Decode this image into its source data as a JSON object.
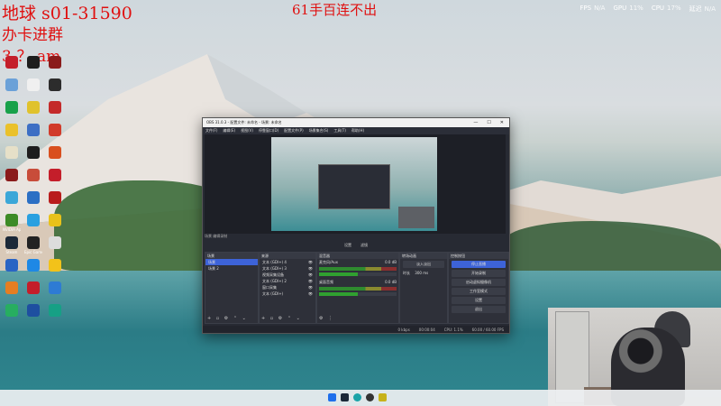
{
  "overlay": {
    "line1": "地球 s01-31590",
    "line2": "办卡进群",
    "line3": "3-？ am",
    "center": "61手百连不出"
  },
  "stats": {
    "fps_label": "FPS",
    "fps_value": "N/A",
    "gpu_label": "GPU",
    "gpu_value": "11%",
    "cpu_label": "CPU",
    "cpu_value": "17%",
    "latency_label": "延迟",
    "latency_value": "N/A"
  },
  "desktop_icons": [
    {
      "label": "",
      "color": "#c41e2a"
    },
    {
      "label": "",
      "color": "#1d1d1d"
    },
    {
      "label": "",
      "color": "#8a1b1b"
    },
    {
      "label": "",
      "color": "#6ba1d8"
    },
    {
      "label": "",
      "color": "#f0f0f0"
    },
    {
      "label": "",
      "color": "#2c2c2c"
    },
    {
      "label": "",
      "color": "#18a14a"
    },
    {
      "label": "",
      "color": "#e0c22c"
    },
    {
      "label": "",
      "color": "#c42a2a"
    },
    {
      "label": "",
      "color": "#eac12a"
    },
    {
      "label": "",
      "color": "#3c6fc4"
    },
    {
      "label": "",
      "color": "#d13b2a"
    },
    {
      "label": "",
      "color": "#e6e0c8"
    },
    {
      "label": "",
      "color": "#1d1d1d"
    },
    {
      "label": "",
      "color": "#d94f1e"
    },
    {
      "label": "",
      "color": "#8a1b1b"
    },
    {
      "label": "",
      "color": "#c84c3a"
    },
    {
      "label": "",
      "color": "#c41e2a"
    },
    {
      "label": "",
      "color": "#3ba7d8"
    },
    {
      "label": "",
      "color": "#2b6fc4"
    },
    {
      "label": "",
      "color": "#b91c1c"
    },
    {
      "label": "NVIDIA App",
      "color": "#3d8b26"
    },
    {
      "label": "",
      "color": "#2aa0e0"
    },
    {
      "label": "",
      "color": "#e8c21a"
    },
    {
      "label": "Steam",
      "color": "#1b2838"
    },
    {
      "label": "Epic Games",
      "color": "#222"
    },
    {
      "label": "",
      "color": "#dcdcdc"
    },
    {
      "label": "",
      "color": "#2a64c4"
    },
    {
      "label": "",
      "color": "#1e88e5"
    },
    {
      "label": "",
      "color": "#f2c21a"
    },
    {
      "label": "",
      "color": "#e67e22"
    },
    {
      "label": "",
      "color": "#c41e2a"
    },
    {
      "label": "",
      "color": "#2e7bd4"
    },
    {
      "label": "",
      "color": "#27ae60"
    },
    {
      "label": "",
      "color": "#1e4fa0"
    },
    {
      "label": "",
      "color": "#16a085"
    }
  ],
  "obs": {
    "title": "OBS 31.0.3 - 配置文件: 未命名 - 场景: 未命名",
    "menu": [
      "文件(F)",
      "编辑(E)",
      "视图(V)",
      "停靠窗口(D)",
      "配置文件(P)",
      "场景集合(S)",
      "工具(T)",
      "帮助(H)"
    ],
    "status_line": "场景    编辑录制",
    "tabs": [
      "设置",
      "滤镜"
    ],
    "scenes_header": "场景",
    "scenes": [
      "场景",
      "场景 2"
    ],
    "sources_header": "来源",
    "sources": [
      "文本 (GDI+) 4",
      "文本 (GDI+) 3",
      "视频采集设备",
      "文本 (GDI+) 2",
      "窗口采集",
      "文本 (GDI+)"
    ],
    "mixer_header": "混音器",
    "mixer": [
      {
        "name": "麦克风/Aux",
        "db": "0.0 dB"
      },
      {
        "name": "桌面音频",
        "db": "0.0 dB"
      }
    ],
    "transition_header": "转场动画",
    "transition_name": "淡入淡出",
    "transition_duration_label": "时长",
    "transition_duration": "300 ms",
    "controls_header": "控制按钮",
    "controls": [
      "停止直播",
      "开始录制",
      "启动虚拟摄像机",
      "工作室模式",
      "设置",
      "退出"
    ],
    "footer": [
      "0 kbps",
      "00:00:04",
      "CPU: 1.1%",
      "60.00 / 60.00 FPS"
    ]
  }
}
